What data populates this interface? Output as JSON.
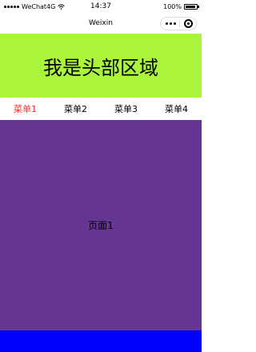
{
  "status_bar": {
    "carrier": "WeChat4G",
    "time": "14:37",
    "battery": "100%"
  },
  "nav_bar": {
    "title": "Weixin"
  },
  "header": {
    "text": "我是头部区域",
    "color": "#aaf43c"
  },
  "menu": {
    "active_color": "#ff2b2b",
    "items": [
      {
        "label": "菜单1",
        "active": true
      },
      {
        "label": "菜单2",
        "active": false
      },
      {
        "label": "菜单3",
        "active": false
      },
      {
        "label": "菜单4",
        "active": false
      }
    ]
  },
  "page": {
    "text": "页面1",
    "color": "#653594"
  },
  "footer": {
    "color": "#0000ff"
  }
}
